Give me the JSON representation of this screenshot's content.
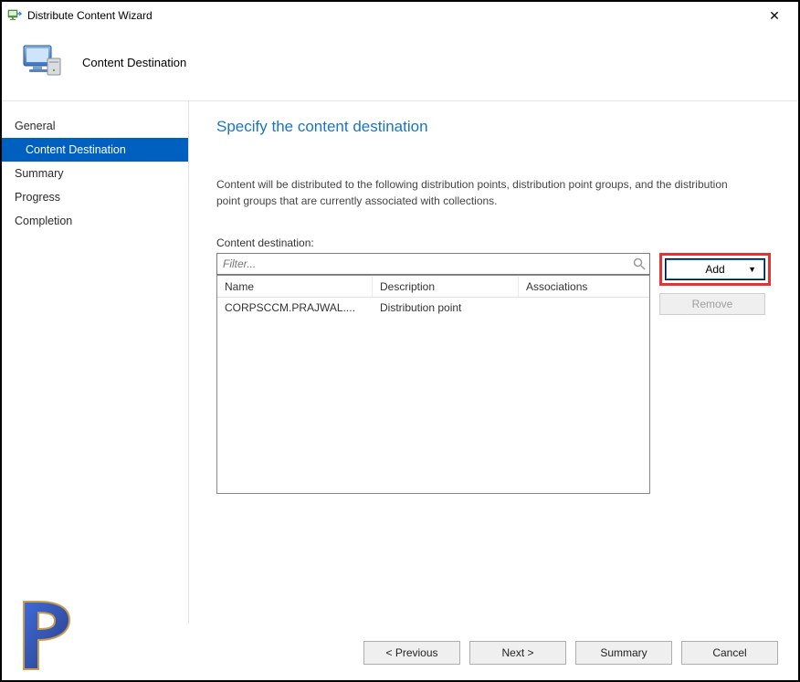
{
  "window": {
    "title": "Distribute Content Wizard"
  },
  "header": {
    "page_name": "Content Destination"
  },
  "sidebar": {
    "items": [
      {
        "label": "General",
        "selected": false,
        "sub": false
      },
      {
        "label": "Content Destination",
        "selected": true,
        "sub": true
      },
      {
        "label": "Summary",
        "selected": false,
        "sub": false
      },
      {
        "label": "Progress",
        "selected": false,
        "sub": false
      },
      {
        "label": "Completion",
        "selected": false,
        "sub": false
      }
    ]
  },
  "content": {
    "section_title": "Specify the content destination",
    "description": "Content will be distributed to the following distribution points, distribution point groups, and the distribution point groups that are currently associated with collections.",
    "field_label": "Content destination:",
    "filter_placeholder": "Filter...",
    "add_label": "Add",
    "remove_label": "Remove",
    "columns": {
      "c1": "Name",
      "c2": "Description",
      "c3": "Associations"
    },
    "rows": [
      {
        "name": "CORPSCCM.PRAJWAL....",
        "description": "Distribution point",
        "associations": ""
      }
    ]
  },
  "footer": {
    "previous": "< Previous",
    "next": "Next >",
    "summary": "Summary",
    "cancel": "Cancel"
  }
}
